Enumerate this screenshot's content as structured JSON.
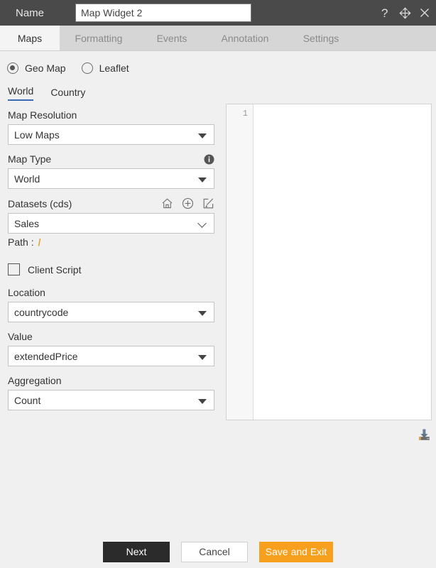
{
  "titlebar": {
    "label": "Name",
    "name_value": "Map Widget 2",
    "name_placeholder": "",
    "help_icon": "help-icon",
    "move_icon": "move-icon",
    "close_icon": "close-icon"
  },
  "tabs": [
    {
      "label": "Maps",
      "active": true
    },
    {
      "label": "Formatting",
      "active": false
    },
    {
      "label": "Events",
      "active": false
    },
    {
      "label": "Annotation",
      "active": false
    },
    {
      "label": "Settings",
      "active": false
    }
  ],
  "map_source": {
    "options": [
      {
        "label": "Geo Map",
        "selected": true
      },
      {
        "label": "Leaflet",
        "selected": false
      }
    ]
  },
  "scope_tabs": [
    {
      "label": "World",
      "active": true
    },
    {
      "label": "Country",
      "active": false
    }
  ],
  "fields": {
    "map_resolution": {
      "label": "Map Resolution",
      "value": "Low Maps"
    },
    "map_type": {
      "label": "Map Type",
      "value": "World",
      "info_icon": "info-icon"
    },
    "datasets": {
      "label": "Datasets (cds)",
      "value": "Sales",
      "icons": [
        "home-icon",
        "add-circle-icon",
        "edit-icon"
      ],
      "path_label": "Path :",
      "path_value": "/"
    },
    "client_script": {
      "label": "Client Script",
      "checked": false
    },
    "location": {
      "label": "Location",
      "value": "countrycode"
    },
    "value": {
      "label": "Value",
      "value": "extendedPrice"
    },
    "aggregation": {
      "label": "Aggregation",
      "value": "Count"
    }
  },
  "editor": {
    "line_numbers": [
      "1"
    ],
    "content": "",
    "download_icon": "download-icon"
  },
  "footer": {
    "next": "Next",
    "cancel": "Cancel",
    "save": "Save and Exit"
  },
  "colors": {
    "titlebar": "#4a4a4a",
    "accent_underline": "#3b6bb5",
    "save_button": "#f6a01e",
    "next_button": "#2b2b2b",
    "path_slash": "#e8a33d"
  }
}
